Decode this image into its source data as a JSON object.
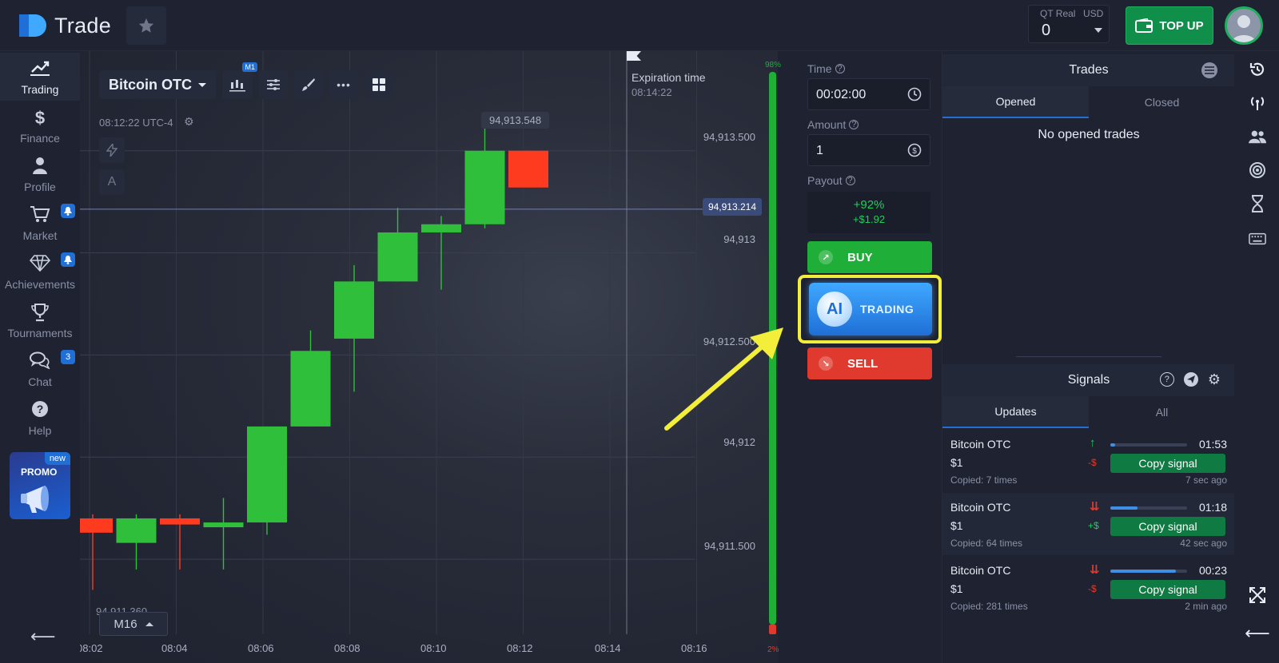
{
  "header": {
    "logo_text": "Trade",
    "account_label": "QT Real",
    "account_currency": "USD",
    "balance": "0",
    "topup_label": "TOP UP"
  },
  "sidebar": {
    "items": [
      {
        "label": "Trading",
        "icon": "trading-chart-icon",
        "active": true
      },
      {
        "label": "Finance",
        "icon": "dollar-icon"
      },
      {
        "label": "Profile",
        "icon": "user-icon"
      },
      {
        "label": "Market",
        "icon": "cart-icon",
        "badge": "bell"
      },
      {
        "label": "Achievements",
        "icon": "diamond-icon",
        "badge": "bell"
      },
      {
        "label": "Tournaments",
        "icon": "trophy-icon"
      },
      {
        "label": "Chat",
        "icon": "chat-icon",
        "badge": "3"
      },
      {
        "label": "Help",
        "icon": "help-icon"
      }
    ],
    "promo_label": "PROMO",
    "promo_new": "new"
  },
  "chart": {
    "asset": "Bitcoin OTC",
    "timeframe_badge": "M1",
    "clock": "08:12:22 UTC-4",
    "expiration_label": "Expiration time",
    "expiration_time": "08:14:22",
    "high_label": "94,913.548",
    "current_price": "94,913.214",
    "low_label": "94,911.360",
    "price_labels": [
      "94,913.500",
      "94,913",
      "94,912.500",
      "94,912",
      "94,911.500"
    ],
    "x_labels": [
      "08:02",
      "08:04",
      "08:06",
      "08:08",
      "08:10",
      "08:12",
      "08:14",
      "08:16"
    ],
    "timeframe_select": "M16",
    "strength_top": "98%",
    "strength_bottom": "2%",
    "up_color": "#2fbf3a",
    "down_color": "#ff3b1f"
  },
  "chart_data": {
    "type": "candlestick",
    "note_axis": "price",
    "x": [
      "08:02",
      "08:03",
      "08:04",
      "08:05",
      "08:06",
      "08:07",
      "08:08",
      "08:09",
      "08:10",
      "08:11",
      "08:12"
    ],
    "candles": [
      {
        "o": 94911.7,
        "c": 94911.63,
        "h": 94911.72,
        "l": 94911.35
      },
      {
        "o": 94911.58,
        "c": 94911.7,
        "h": 94911.72,
        "l": 94911.45
      },
      {
        "o": 94911.7,
        "c": 94911.67,
        "h": 94911.72,
        "l": 94911.45
      },
      {
        "o": 94911.66,
        "c": 94911.68,
        "h": 94911.8,
        "l": 94911.45
      },
      {
        "o": 94911.68,
        "c": 94912.15,
        "h": 94912.15,
        "l": 94911.62
      },
      {
        "o": 94912.15,
        "c": 94912.52,
        "h": 94912.62,
        "l": 94912.15
      },
      {
        "o": 94912.58,
        "c": 94912.86,
        "h": 94912.94,
        "l": 94912.32
      },
      {
        "o": 94912.86,
        "c": 94913.1,
        "h": 94913.22,
        "l": 94912.86
      },
      {
        "o": 94913.1,
        "c": 94913.14,
        "h": 94913.18,
        "l": 94912.82
      },
      {
        "o": 94913.14,
        "c": 94913.5,
        "h": 94913.65,
        "l": 94913.12
      },
      {
        "o": 94913.5,
        "c": 94913.32,
        "h": 94913.5,
        "l": 94913.32
      }
    ],
    "ylim": [
      94911.25,
      94913.8
    ]
  },
  "trade": {
    "time_label": "Time",
    "time_value": "00:02:00",
    "amount_label": "Amount",
    "amount_value": "1",
    "payout_label": "Payout",
    "payout_pct": "+92%",
    "payout_amt": "+$1.92",
    "buy_label": "BUY",
    "ai_label": "AI",
    "ai_trading_label": "TRADING",
    "sell_label": "SELL"
  },
  "trades": {
    "title": "Trades",
    "tabs": [
      "Opened",
      "Closed"
    ],
    "empty": "No opened trades"
  },
  "signals": {
    "title": "Signals",
    "tabs": [
      "Updates",
      "All"
    ],
    "items": [
      {
        "asset": "Bitcoin OTC",
        "amount": "$1",
        "copied": "Copied: 7 times",
        "dir": "↑",
        "dir_color": "#1fcf5a",
        "pl": "-$",
        "pl_color": "#e03a2e",
        "progress": 0.06,
        "timer": "01:53",
        "copy": "Copy signal",
        "ago": "7 sec ago"
      },
      {
        "asset": "Bitcoin OTC",
        "amount": "$1",
        "copied": "Copied: 64 times",
        "dir": "⇊",
        "dir_color": "#e03a2e",
        "pl": "+$",
        "pl_color": "#1fcf5a",
        "progress": 0.35,
        "timer": "01:18",
        "copy": "Copy signal",
        "ago": "42 sec ago"
      },
      {
        "asset": "Bitcoin OTC",
        "amount": "$1",
        "copied": "Copied: 281 times",
        "dir": "⇊",
        "dir_color": "#e03a2e",
        "pl": "-$",
        "pl_color": "#e03a2e",
        "progress": 0.85,
        "timer": "00:23",
        "copy": "Copy signal",
        "ago": "2 min ago"
      }
    ]
  },
  "rail_icons": [
    "history-icon",
    "signal-antenna-icon",
    "users-icon",
    "target-icon",
    "hourglass-icon",
    "keyboard-icon"
  ]
}
